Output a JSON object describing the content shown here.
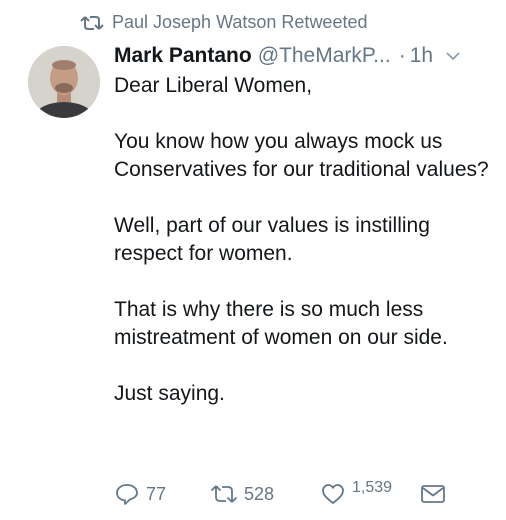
{
  "retweet_header": {
    "icon": "retweet-icon",
    "text": "Paul Joseph Watson Retweeted"
  },
  "author": {
    "display_name": "Mark Pantano",
    "handle": "@TheMarkP...",
    "separator": "·",
    "time": "1h"
  },
  "tweet": {
    "paragraphs": [
      "Dear Liberal Women,",
      "You know how you always mock us Conservatives for our traditional values?",
      "Well, part of our values is instilling respect for women.",
      "That is why there is so much less mistreatment of women on our side.",
      "Just saying."
    ]
  },
  "actions": {
    "reply_count": "77",
    "retweet_count": "528",
    "like_count": "1,539",
    "icons": [
      "reply-icon",
      "retweet-icon",
      "like-icon",
      "message-icon"
    ]
  },
  "colors": {
    "text": "#14171a",
    "secondary": "#657786"
  }
}
